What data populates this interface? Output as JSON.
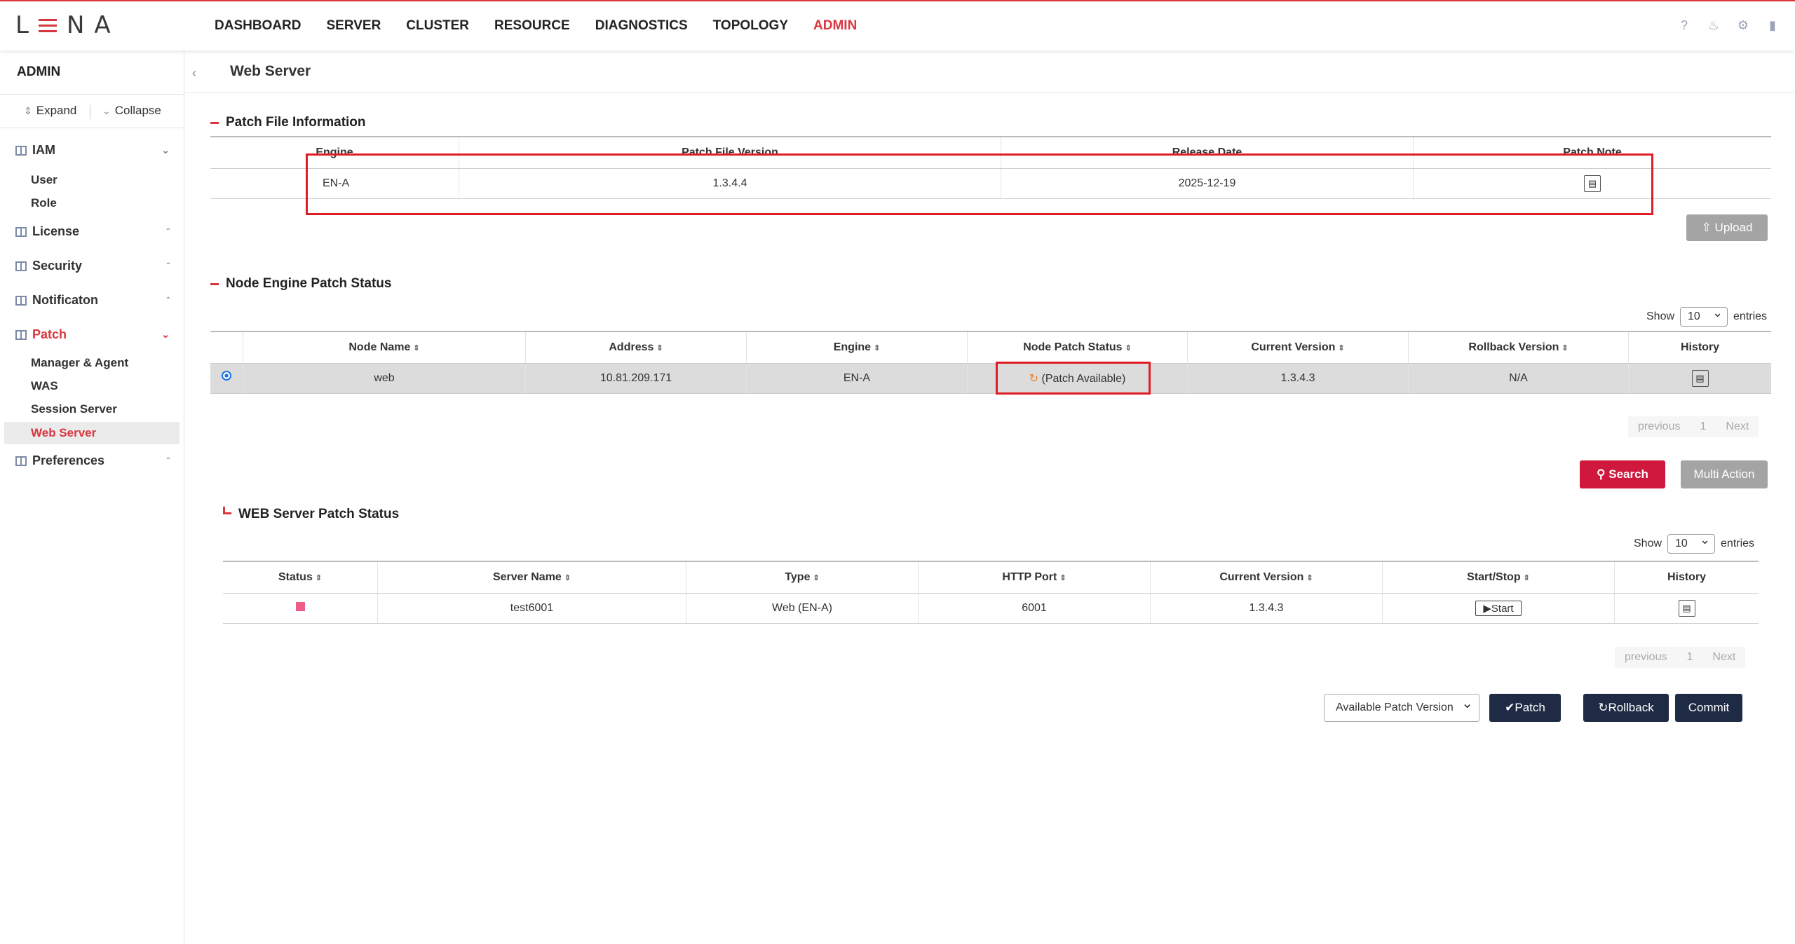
{
  "app": {
    "logo": "LENA"
  },
  "nav": [
    "DASHBOARD",
    "SERVER",
    "CLUSTER",
    "RESOURCE",
    "DIAGNOSTICS",
    "TOPOLOGY",
    "ADMIN"
  ],
  "sidebar": {
    "title": "ADMIN",
    "expand": "Expand",
    "collapse": "Collapse",
    "groups": [
      {
        "label": "IAM",
        "items": [
          "User",
          "Role"
        ]
      },
      {
        "label": "License"
      },
      {
        "label": "Security"
      },
      {
        "label": "Notificaton"
      },
      {
        "label": "Patch",
        "items": [
          "Manager & Agent",
          "WAS",
          "Session Server",
          "Web Server"
        ]
      },
      {
        "label": "Preferences"
      }
    ]
  },
  "page": {
    "title": "Web Server"
  },
  "patch_file": {
    "title": "Patch File Information",
    "headers": [
      "Engine",
      "Patch File Version",
      "Release Date",
      "Patch Note"
    ],
    "row": {
      "engine": "EN-A",
      "version": "1.3.4.4",
      "date": "2025-12-19"
    },
    "upload": "Upload"
  },
  "node_status": {
    "title": "Node Engine Patch Status",
    "show": "Show",
    "entries": "entries",
    "page_size": "10",
    "headers": [
      "Node Name",
      "Address",
      "Engine",
      "Node Patch Status",
      "Current Version",
      "Rollback Version",
      "History"
    ],
    "row": {
      "name": "web",
      "address": "10.81.209.171",
      "engine": "EN-A",
      "status": "(Patch Available)",
      "current": "1.3.4.3",
      "rollback": "N/A"
    },
    "previous": "previous",
    "page": "1",
    "next": "Next",
    "search": "Search",
    "multi": "Multi Action"
  },
  "web_status": {
    "title": "WEB Server Patch Status",
    "show": "Show",
    "entries": "entries",
    "page_size": "10",
    "headers": [
      "Status",
      "Server Name",
      "Type",
      "HTTP Port",
      "Current Version",
      "Start/Stop",
      "History"
    ],
    "row": {
      "name": "test6001",
      "type": "Web (EN-A)",
      "port": "6001",
      "current": "1.3.4.3",
      "start": "Start"
    },
    "previous": "previous",
    "page": "1",
    "next": "Next"
  },
  "actions": {
    "version_select": "Available Patch Version",
    "patch": "Patch",
    "rollback": "Rollback",
    "commit": "Commit"
  }
}
